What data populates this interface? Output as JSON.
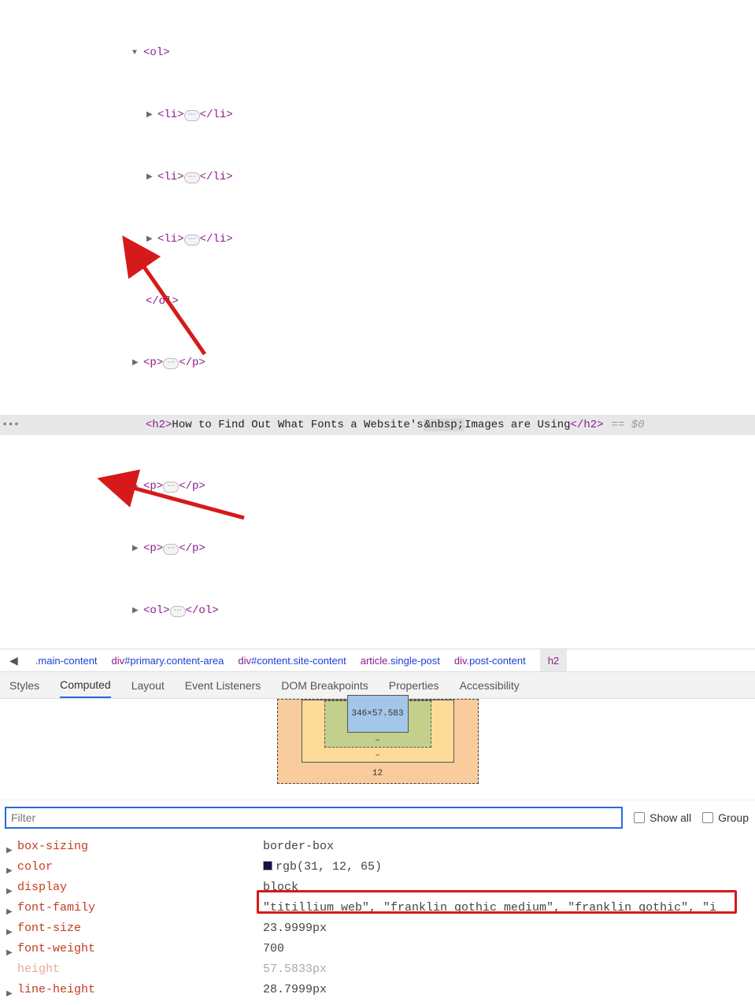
{
  "dom": {
    "ol_open": "<ol>",
    "ol_close": "</ol>",
    "li_open": "<li>",
    "li_close": "</li>",
    "p_open": "<p>",
    "p_close": "</p>",
    "h2_open": "<h2>",
    "h2_close": "</h2>",
    "h2_text_before": "How to Find Out What Fonts a Website's",
    "h2_entity": "&nbsp;",
    "h2_text_after": "Images are Using",
    "eq0": "== $0",
    "ellipsis": "⋯",
    "ol_self_open": "<ol>",
    "ol_self_close": "</ol>"
  },
  "crumbs": {
    "back": "◀",
    "c1": ".main-content",
    "c2_tag": "div",
    "c2_id": "#primary",
    "c2_cls": ".content-area",
    "c3_tag": "div",
    "c3_id": "#content",
    "c3_cls": ".site-content",
    "c4_tag": "article",
    "c4_cls": ".single-post",
    "c5_tag": "div",
    "c5_cls": ".post-content",
    "c6": "h2"
  },
  "tabs": {
    "styles": "Styles",
    "computed": "Computed",
    "layout": "Layout",
    "event_listeners": "Event Listeners",
    "dom_breakpoints": "DOM Breakpoints",
    "properties": "Properties",
    "accessibility": "Accessibility"
  },
  "boxmodel": {
    "content": "346×57.583",
    "dash": "–",
    "margin_bottom": "12"
  },
  "filter": {
    "placeholder": "Filter",
    "show_all": "Show all",
    "group": "Group"
  },
  "computed": [
    {
      "name": "box-sizing",
      "value": "border-box"
    },
    {
      "name": "color",
      "value": "rgb(31, 12, 65)",
      "swatch": "#1f0c41"
    },
    {
      "name": "display",
      "value": "block"
    },
    {
      "name": "font-family",
      "value": "\"titillium web\", \"franklin gothic medium\", \"franklin gothic\", \"i"
    },
    {
      "name": "font-size",
      "value": "23.9999px"
    },
    {
      "name": "font-weight",
      "value": "700"
    },
    {
      "name": "height",
      "value": "57.5833px",
      "faded": true
    },
    {
      "name": "line-height",
      "value": "28.7999px"
    }
  ]
}
